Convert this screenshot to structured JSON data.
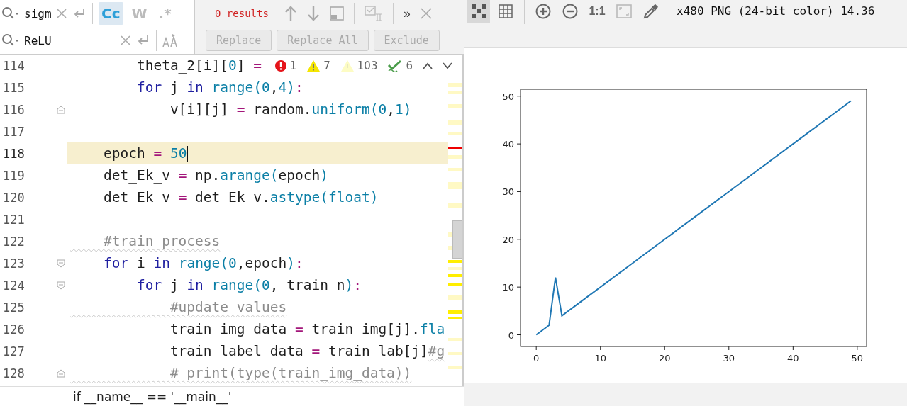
{
  "find_bar": {
    "search": {
      "value": "sigm"
    },
    "options": [
      {
        "label": "Cc",
        "on": true
      },
      {
        "label": "W",
        "on": false
      },
      {
        "label": ".*",
        "on": false
      }
    ],
    "results": "0 results",
    "more": "»",
    "replace": {
      "value": "ReLU"
    },
    "buttons": [
      {
        "label": "Replace",
        "disabled": true
      },
      {
        "label": "Replace All",
        "disabled": true
      },
      {
        "label": "Exclude",
        "disabled": true
      }
    ]
  },
  "editor": {
    "problems": [
      {
        "kind": "error",
        "count": "1"
      },
      {
        "kind": "warning",
        "count": "7"
      },
      {
        "kind": "weak",
        "count": "103"
      },
      {
        "kind": "typo",
        "count": "6"
      }
    ],
    "lines": [
      {
        "number": "114",
        "current": false,
        "fold_start": false,
        "fold_end": false,
        "tokens": [
          {
            "text": "        theta_2[i][",
            "kind": "text"
          },
          {
            "text": "0",
            "kind": "num"
          },
          {
            "text": "] ",
            "kind": "text"
          },
          {
            "text": "=",
            "kind": "op"
          }
        ]
      },
      {
        "number": "115",
        "current": false,
        "fold_start": false,
        "fold_end": false,
        "tokens": [
          {
            "text": "        for",
            "kind": "kw"
          },
          {
            "text": " j ",
            "kind": "text"
          },
          {
            "text": "in",
            "kind": "kw"
          },
          {
            "text": " range(",
            "kind": "fn"
          },
          {
            "text": "0",
            "kind": "num"
          },
          {
            "text": ",",
            "kind": "text"
          },
          {
            "text": "4",
            "kind": "num"
          },
          {
            "text": ")",
            "kind": "fn"
          },
          {
            "text": ":",
            "kind": "op"
          }
        ]
      },
      {
        "number": "116",
        "current": false,
        "fold_start": false,
        "fold_end": true,
        "tokens": [
          {
            "text": "            v[i][j] ",
            "kind": "text"
          },
          {
            "text": "=",
            "kind": "op"
          },
          {
            "text": " random.",
            "kind": "text"
          },
          {
            "text": "uniform(",
            "kind": "fn"
          },
          {
            "text": "0",
            "kind": "num"
          },
          {
            "text": ",",
            "kind": "text"
          },
          {
            "text": "1",
            "kind": "num"
          },
          {
            "text": ")",
            "kind": "fn"
          }
        ]
      },
      {
        "number": "117",
        "current": false,
        "fold_start": false,
        "fold_end": false
      },
      {
        "number": "118",
        "current": true,
        "fold_start": false,
        "fold_end": false,
        "tokens": [
          {
            "text": "    epoch ",
            "kind": "text"
          },
          {
            "text": "=",
            "kind": "op"
          },
          {
            "text": " 50",
            "kind": "num"
          }
        ]
      },
      {
        "number": "119",
        "current": false,
        "fold_start": false,
        "fold_end": false,
        "tokens": [
          {
            "text": "    det_Ek_v ",
            "kind": "text"
          },
          {
            "text": "=",
            "kind": "op"
          },
          {
            "text": " np.",
            "kind": "text"
          },
          {
            "text": "arange(",
            "kind": "fn"
          },
          {
            "text": "epoch",
            "kind": "text"
          },
          {
            "text": ")",
            "kind": "fn"
          }
        ]
      },
      {
        "number": "120",
        "current": false,
        "fold_start": false,
        "fold_end": false,
        "tokens": [
          {
            "text": "    det_Ek_v ",
            "kind": "text"
          },
          {
            "text": "=",
            "kind": "op"
          },
          {
            "text": " det_Ek_v.",
            "kind": "text"
          },
          {
            "text": "astype(",
            "kind": "fn"
          },
          {
            "text": "float",
            "kind": "fn"
          },
          {
            "text": ")",
            "kind": "fn"
          }
        ]
      },
      {
        "number": "121",
        "current": false,
        "fold_start": false,
        "fold_end": false
      },
      {
        "number": "122",
        "current": false,
        "fold_start": false,
        "fold_end": false,
        "tokens": [
          {
            "text": "    #train process",
            "kind": "comment"
          }
        ]
      },
      {
        "number": "123",
        "current": false,
        "fold_start": true,
        "fold_end": false,
        "tokens": [
          {
            "text": "    for",
            "kind": "kw"
          },
          {
            "text": " i ",
            "kind": "text"
          },
          {
            "text": "in",
            "kind": "kw"
          },
          {
            "text": " range(",
            "kind": "fn"
          },
          {
            "text": "0",
            "kind": "num"
          },
          {
            "text": ",epoch",
            "kind": "text"
          },
          {
            "text": ")",
            "kind": "fn"
          },
          {
            "text": ":",
            "kind": "op"
          }
        ]
      },
      {
        "number": "124",
        "current": false,
        "fold_start": true,
        "fold_end": false,
        "tokens": [
          {
            "text": "        for",
            "kind": "kw"
          },
          {
            "text": " j ",
            "kind": "text"
          },
          {
            "text": "in",
            "kind": "kw"
          },
          {
            "text": " range(",
            "kind": "fn"
          },
          {
            "text": "0",
            "kind": "num"
          },
          {
            "text": ", train_n",
            "kind": "text"
          },
          {
            "text": ")",
            "kind": "fn"
          },
          {
            "text": ":",
            "kind": "op"
          }
        ]
      },
      {
        "number": "125",
        "current": false,
        "fold_start": false,
        "fold_end": false,
        "tokens": [
          {
            "text": "            #update values",
            "kind": "comment"
          }
        ]
      },
      {
        "number": "126",
        "current": false,
        "fold_start": false,
        "fold_end": false,
        "tokens": [
          {
            "text": "            train_img_data ",
            "kind": "text"
          },
          {
            "text": "=",
            "kind": "op"
          },
          {
            "text": " train_img[j].",
            "kind": "text"
          },
          {
            "text": "fla",
            "kind": "fn"
          }
        ]
      },
      {
        "number": "127",
        "current": false,
        "fold_start": false,
        "fold_end": false,
        "tokens": [
          {
            "text": "            train_label_data ",
            "kind": "text"
          },
          {
            "text": "=",
            "kind": "op"
          },
          {
            "text": " train_lab[j]",
            "kind": "text"
          },
          {
            "text": "#g",
            "kind": "comment"
          }
        ]
      },
      {
        "number": "128",
        "current": false,
        "fold_start": false,
        "fold_end": true,
        "tokens": [
          {
            "text": "            # print(type(train_img_data))",
            "kind": "comment"
          }
        ]
      }
    ],
    "breadcrumb": "if __name__ == '__main__'"
  },
  "image_viewer": {
    "tools": [
      {
        "kind": "checkerboard",
        "on": true
      },
      {
        "kind": "grid",
        "on": false
      },
      {
        "kind": "zoom-in",
        "on": false
      },
      {
        "kind": "zoom-out",
        "on": false
      },
      {
        "kind": "actual-size",
        "label": "1:1",
        "on": false
      },
      {
        "kind": "fit",
        "on": false,
        "disabled": true
      },
      {
        "kind": "picker",
        "on": false
      }
    ],
    "info": "x480 PNG (24-bit color) 14.36",
    "chart_data": {
      "type": "line",
      "xlim": [
        -2.45,
        51.45
      ],
      "ylim": [
        -2.45,
        51.45
      ],
      "xticks": [
        0,
        10,
        20,
        30,
        40,
        50
      ],
      "yticks": [
        0,
        10,
        20,
        30,
        40,
        50
      ],
      "x": [
        0,
        1,
        2,
        3,
        4,
        5,
        6,
        7,
        8,
        9,
        10,
        11,
        12,
        13,
        14,
        15,
        16,
        17,
        18,
        19,
        20,
        21,
        22,
        23,
        24,
        25,
        26,
        27,
        28,
        29,
        30,
        31,
        32,
        33,
        34,
        35,
        36,
        37,
        38,
        39,
        40,
        41,
        42,
        43,
        44,
        45,
        46,
        47,
        48,
        49
      ],
      "series": [
        {
          "color": "#1f77b4",
          "values": [
            0,
            1,
            2,
            12,
            4,
            5,
            6,
            7,
            8,
            9,
            10,
            11,
            12,
            13,
            14,
            15,
            16,
            17,
            18,
            19,
            20,
            21,
            22,
            23,
            24,
            25,
            26,
            27,
            28,
            29,
            30,
            31,
            32,
            33,
            34,
            35,
            36,
            37,
            38,
            39,
            40,
            41,
            42,
            43,
            44,
            45,
            46,
            47,
            48,
            49
          ]
        }
      ]
    }
  }
}
